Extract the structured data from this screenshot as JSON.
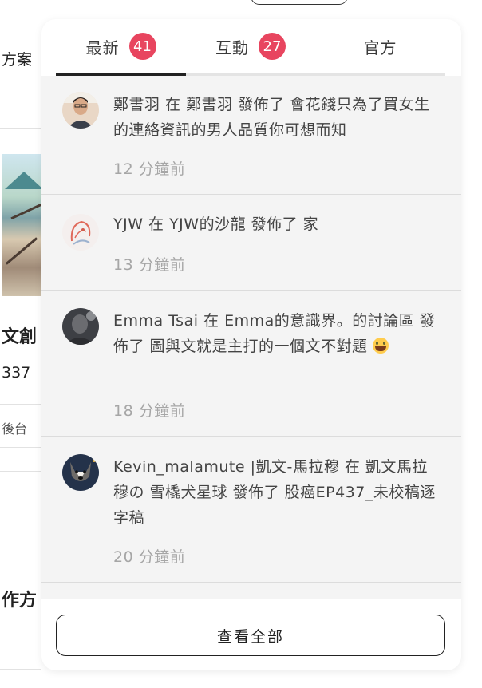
{
  "background": {
    "texts": [
      "方案",
      "文創",
      "337",
      "後台",
      "作方"
    ]
  },
  "tabs": [
    {
      "label": "最新",
      "badge": "41",
      "active": true
    },
    {
      "label": "互動",
      "badge": "27",
      "active": false
    },
    {
      "label": "官方",
      "badge": null,
      "active": false
    }
  ],
  "notifications": [
    {
      "message": "鄭書羽 在 鄭書羽 發佈了 會花錢只為了買女生的連絡資訊的男人品質你可想而知",
      "time": "12 分鐘前"
    },
    {
      "message": "YJW 在 YJW的沙龍 發佈了 家",
      "time": "13 分鐘前"
    },
    {
      "message": "Emma Tsai 在 Emma的意識界。的討論區 發佈了 圖與文就是主打的一個文不對題",
      "time": "18 分鐘前"
    },
    {
      "message": "Kevin_malamute |凱文-馬拉穆 在 凱文馬拉穆の 雪橇犬星球 發佈了 股癌EP437_未校稿逐字稿",
      "time": "20 分鐘前"
    }
  ],
  "footer": {
    "view_all_label": "查看全部"
  },
  "colors": {
    "badge": "#e8455f",
    "list_bg": "#f4f4f4",
    "time": "#a6a6a6"
  }
}
